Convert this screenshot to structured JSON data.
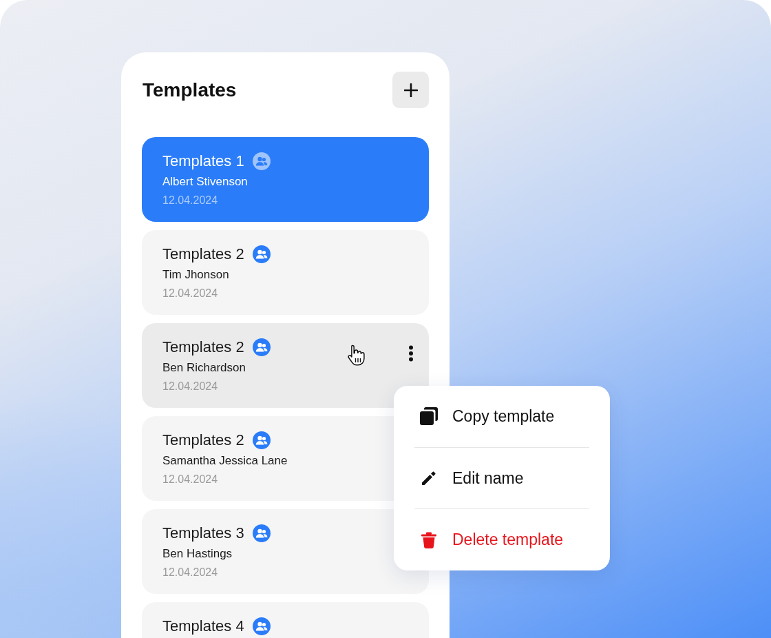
{
  "panel": {
    "title": "Templates"
  },
  "templates": [
    {
      "title": "Templates 1",
      "author": "Albert Stivenson",
      "date": "12.04.2024",
      "selected": true,
      "hovered": false
    },
    {
      "title": "Templates 2",
      "author": "Tim Jhonson",
      "date": "12.04.2024",
      "selected": false,
      "hovered": false
    },
    {
      "title": "Templates 2",
      "author": "Ben Richardson",
      "date": "12.04.2024",
      "selected": false,
      "hovered": true
    },
    {
      "title": "Templates 2",
      "author": "Samantha Jessica Lane",
      "date": "12.04.2024",
      "selected": false,
      "hovered": false
    },
    {
      "title": "Templates 3",
      "author": "Ben Hastings",
      "date": "12.04.2024",
      "selected": false,
      "hovered": false
    },
    {
      "title": "Templates 4",
      "selected": false,
      "hovered": false
    }
  ],
  "context_menu": {
    "items": [
      {
        "label": "Copy template",
        "kind": "copy"
      },
      {
        "label": "Edit name",
        "kind": "edit"
      },
      {
        "label": "Delete template",
        "kind": "delete"
      }
    ]
  }
}
